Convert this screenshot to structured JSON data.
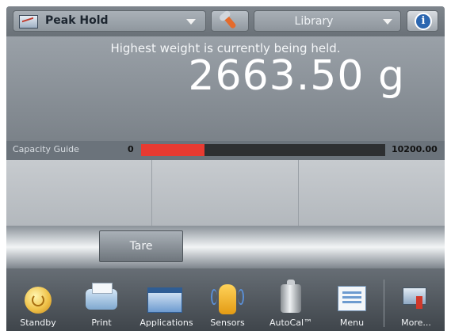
{
  "header": {
    "application": "Peak Hold",
    "library": "Library",
    "icons": [
      "peak-hold-app-icon",
      "wrench-icon",
      "info-icon"
    ]
  },
  "weight": {
    "status_message": "Highest weight is currently being held.",
    "value": "2663.50 g"
  },
  "capacity_guide": {
    "label": "Capacity Guide",
    "min": "0",
    "max": "10200.00",
    "fill_fraction": 0.26,
    "fill_color": "#e83a31"
  },
  "panels": [
    {
      "label": ""
    },
    {
      "label": ""
    },
    {
      "label": ""
    }
  ],
  "tare": {
    "label": "Tare"
  },
  "nav": [
    {
      "label": "Standby",
      "icon": "standby-icon"
    },
    {
      "label": "Print",
      "icon": "print-icon"
    },
    {
      "label": "Applications",
      "icon": "applications-icon"
    },
    {
      "label": "Sensors",
      "icon": "sensors-icon"
    },
    {
      "label": "AutoCal™",
      "icon": "autocal-icon"
    },
    {
      "label": "Menu",
      "icon": "menu-icon"
    },
    {
      "label": "More...",
      "icon": "more-icon"
    }
  ]
}
